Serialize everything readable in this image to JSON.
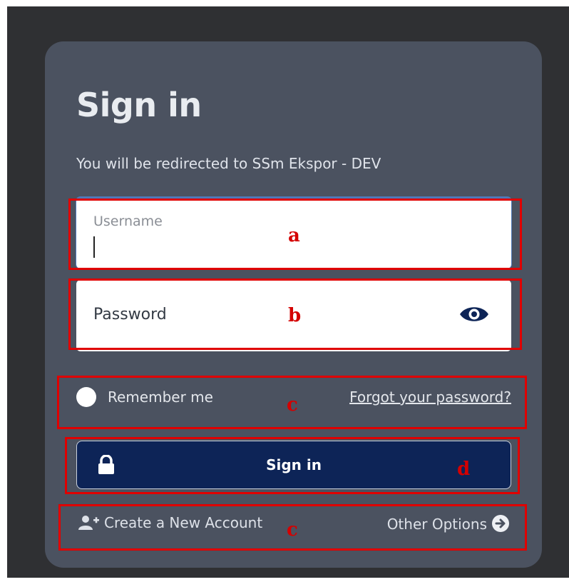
{
  "heading": "Sign in",
  "subtitle": "You will be redirected to SSm Ekspor - DEV",
  "username": {
    "label": "Username",
    "value": ""
  },
  "password": {
    "placeholder": "Password",
    "toggle_icon": "eye-icon"
  },
  "remember_label": "Remember me",
  "forgot_label": "Forgot your password?",
  "signin_button": {
    "label": "Sign in",
    "icon": "lock-icon"
  },
  "create_account_label": "Create a New Account",
  "other_options_label": "Other Options",
  "annotations": [
    "a",
    "b",
    "c",
    "d",
    "c"
  ],
  "colors": {
    "card": "#4b5260",
    "button": "#0d2457",
    "annotation": "#e00000"
  }
}
